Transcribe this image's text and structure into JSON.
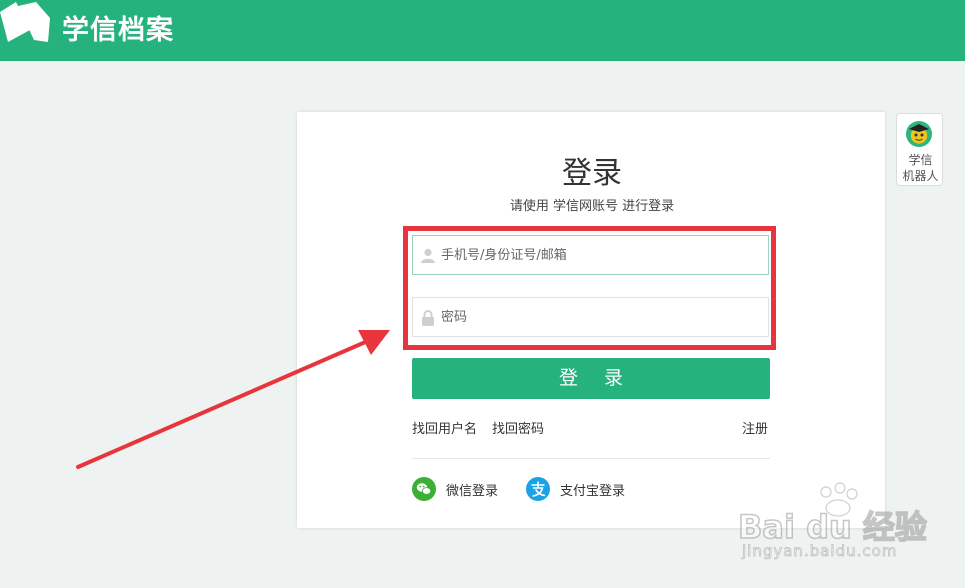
{
  "header": {
    "site_name": "学信档案",
    "brand_color": "#25b27c"
  },
  "login": {
    "title": "登录",
    "subtitle": "请使用 学信网账号 进行登录",
    "username_placeholder": "手机号/身份证号/邮箱",
    "password_placeholder": "密码",
    "submit_label": "登 录",
    "links": {
      "recover_username": "找回用户名",
      "recover_password": "找回密码",
      "register": "注册"
    },
    "social": {
      "wechat_label": "微信登录",
      "alipay_label": "支付宝登录"
    }
  },
  "robot": {
    "line1": "学信",
    "line2": "机器人"
  },
  "watermark": {
    "brand": "Bai du 经验",
    "url": "jingyan.baidu.com"
  },
  "icons": {
    "logo": "open-book-icon",
    "username": "user-icon",
    "password": "lock-icon",
    "wechat": "wechat-icon",
    "alipay": "alipay-icon",
    "robot": "robot-avatar-icon",
    "watermark": "paw-icon"
  },
  "colors": {
    "annotation_red": "#e8343d",
    "wechat_green": "#3cb034",
    "alipay_blue": "#1aa1e6"
  }
}
